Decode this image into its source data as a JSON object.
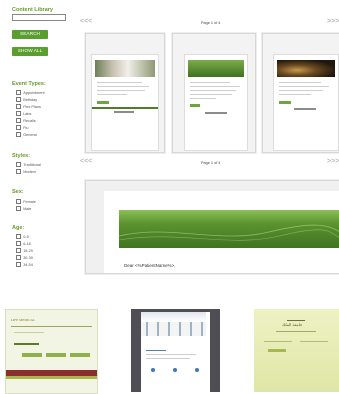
{
  "sidebar": {
    "title": "Content Library",
    "search_label": "SEARCH",
    "show_all_label": "SHOW ALL",
    "event_types": {
      "heading": "Event Types:",
      "items": [
        "Appointment",
        "Birthday",
        "Flex Plans",
        "Labs",
        "Recalls",
        "Flu",
        "General"
      ]
    },
    "styles": {
      "heading": "Styles:",
      "items": [
        "Traditional",
        "Modern"
      ]
    },
    "sex": {
      "heading": "Sex:",
      "items": [
        "Female",
        "Male"
      ]
    },
    "age": {
      "heading": "Age:",
      "items": [
        "0-5",
        "6-18",
        "18-29",
        "30-39",
        "34-54"
      ]
    }
  },
  "carousel1": {
    "page_label": "Page 1 of 4",
    "prev": "<<<",
    "next": ">>>"
  },
  "carousel2": {
    "page_label": "Page 1 of 4",
    "prev": "<<<",
    "next": ">>>",
    "preview_text": "Dear <%PatientName%>,"
  },
  "thumbnails": {
    "logo_left": "LIFE MEDICAL",
    "logo_right": "جامعة الملك"
  },
  "colors": {
    "accent_green": "#5a9e2e",
    "header_green": "#4d7d2a",
    "arrow_gray": "#b9b9b9"
  }
}
